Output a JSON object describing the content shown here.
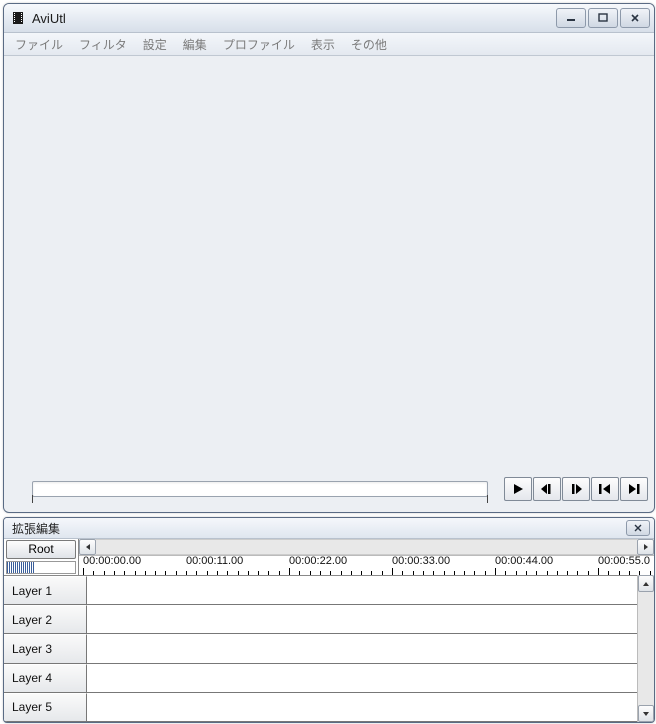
{
  "window": {
    "title": "AviUtl"
  },
  "menu": {
    "items": [
      "ファイル",
      "フィルタ",
      "設定",
      "編集",
      "プロファイル",
      "表示",
      "その他"
    ]
  },
  "ext_window": {
    "title": "拡張編集",
    "root_label": "Root"
  },
  "timeline": {
    "times": [
      "00:00:00.00",
      "00:00:11.00",
      "00:00:22.00",
      "00:00:33.00",
      "00:00:44.00",
      "00:00:55.0"
    ],
    "layers": [
      "Layer 1",
      "Layer 2",
      "Layer 3",
      "Layer 4",
      "Layer 5"
    ]
  }
}
